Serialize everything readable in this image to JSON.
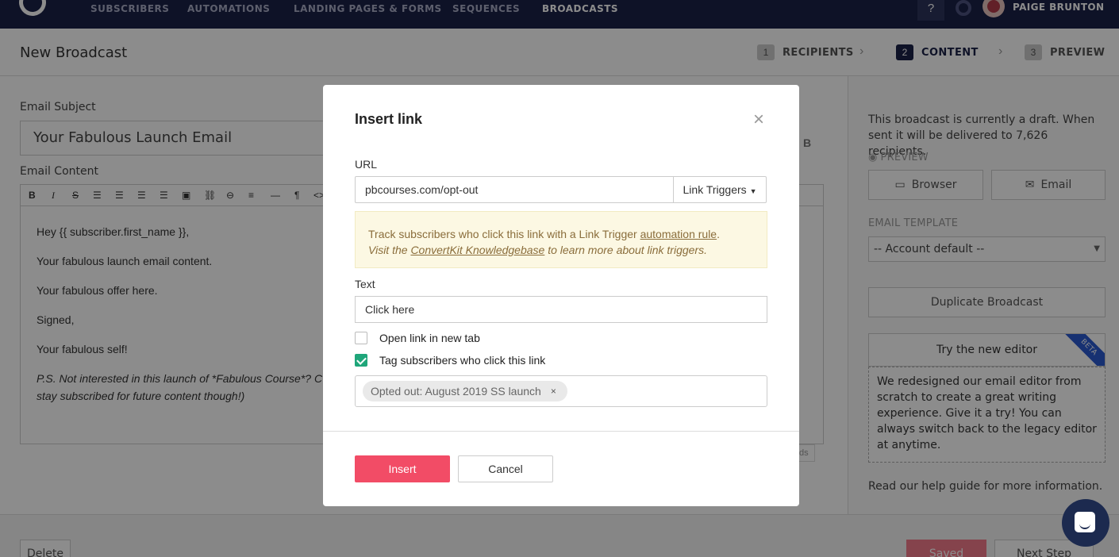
{
  "nav": {
    "items": [
      "SUBSCRIBERS",
      "AUTOMATIONS",
      "LANDING PAGES & FORMS",
      "SEQUENCES",
      "BROADCASTS"
    ],
    "active": "BROADCASTS",
    "help": "?",
    "user": "PAIGE BRUNTON"
  },
  "header": {
    "title": "New Broadcast",
    "steps": [
      {
        "num": "1",
        "label": "RECIPIENTS"
      },
      {
        "num": "2",
        "label": "CONTENT"
      },
      {
        "num": "3",
        "label": "PREVIEW"
      }
    ],
    "active_step": "CONTENT"
  },
  "editor": {
    "subject_label": "Email Subject",
    "subject_value": "Your Fabulous Launch Email",
    "content_label": "Email Content",
    "ab": "B",
    "lines": [
      "Hey {{ subscriber.first_name }},",
      "Your fabulous launch email content.",
      "Your fabulous offer here.",
      "Signed,",
      "Your fabulous self!"
    ],
    "ps_line1": "P.S. Not interested in this launch of *Fabulous Course*? C",
    "ps_line2": "stay subscribed for future content though!)",
    "wordcount_tail": "ds"
  },
  "sidebar": {
    "status_text": "This broadcast is currently a draft. When sent it will be delivered to 7,626 recipients.",
    "preview_label": "PREVIEW",
    "browser_button": "Browser",
    "email_button": "Email",
    "template_label": "EMAIL TEMPLATE",
    "template_value": "-- Account default --",
    "duplicate_button": "Duplicate Broadcast",
    "try_editor_title": "Try the new editor",
    "beta_badge": "BETA",
    "try_editor_body": "We redesigned our email editor from scratch to create a great writing experience. Give it a try! You can always switch back to the legacy editor at anytime.",
    "help_text": "Read our help guide for more information."
  },
  "footer": {
    "delete_button": "Delete",
    "saved_button": "Saved",
    "next_button": "Next Step"
  },
  "modal": {
    "title": "Insert link",
    "close": "×",
    "url_label": "URL",
    "url_value": "pbcourses.com/opt-out",
    "link_triggers_button": "Link Triggers",
    "notice_text": "Track subscribers who click this link with a Link Trigger",
    "notice_link": "automation rule",
    "notice_visit": "Visit the",
    "notice_kb_link": "ConvertKit Knowledgebase",
    "notice_tail": "to learn more about link triggers.",
    "text_label": "Text",
    "text_value": "Click here",
    "new_tab_label": "Open link in new tab",
    "new_tab_checked": false,
    "tag_label": "Tag subscribers who click this link",
    "tag_checked": true,
    "tag_chip": "Opted out: August 2019 SS launch",
    "tag_remove": "×",
    "insert_button": "Insert",
    "cancel_button": "Cancel"
  },
  "colors": {
    "nav_bg": "#1b2147",
    "insert_button": "#f24c66",
    "checkbox_checked": "#1fa67a",
    "notice_bg": "#fcf8e3"
  }
}
